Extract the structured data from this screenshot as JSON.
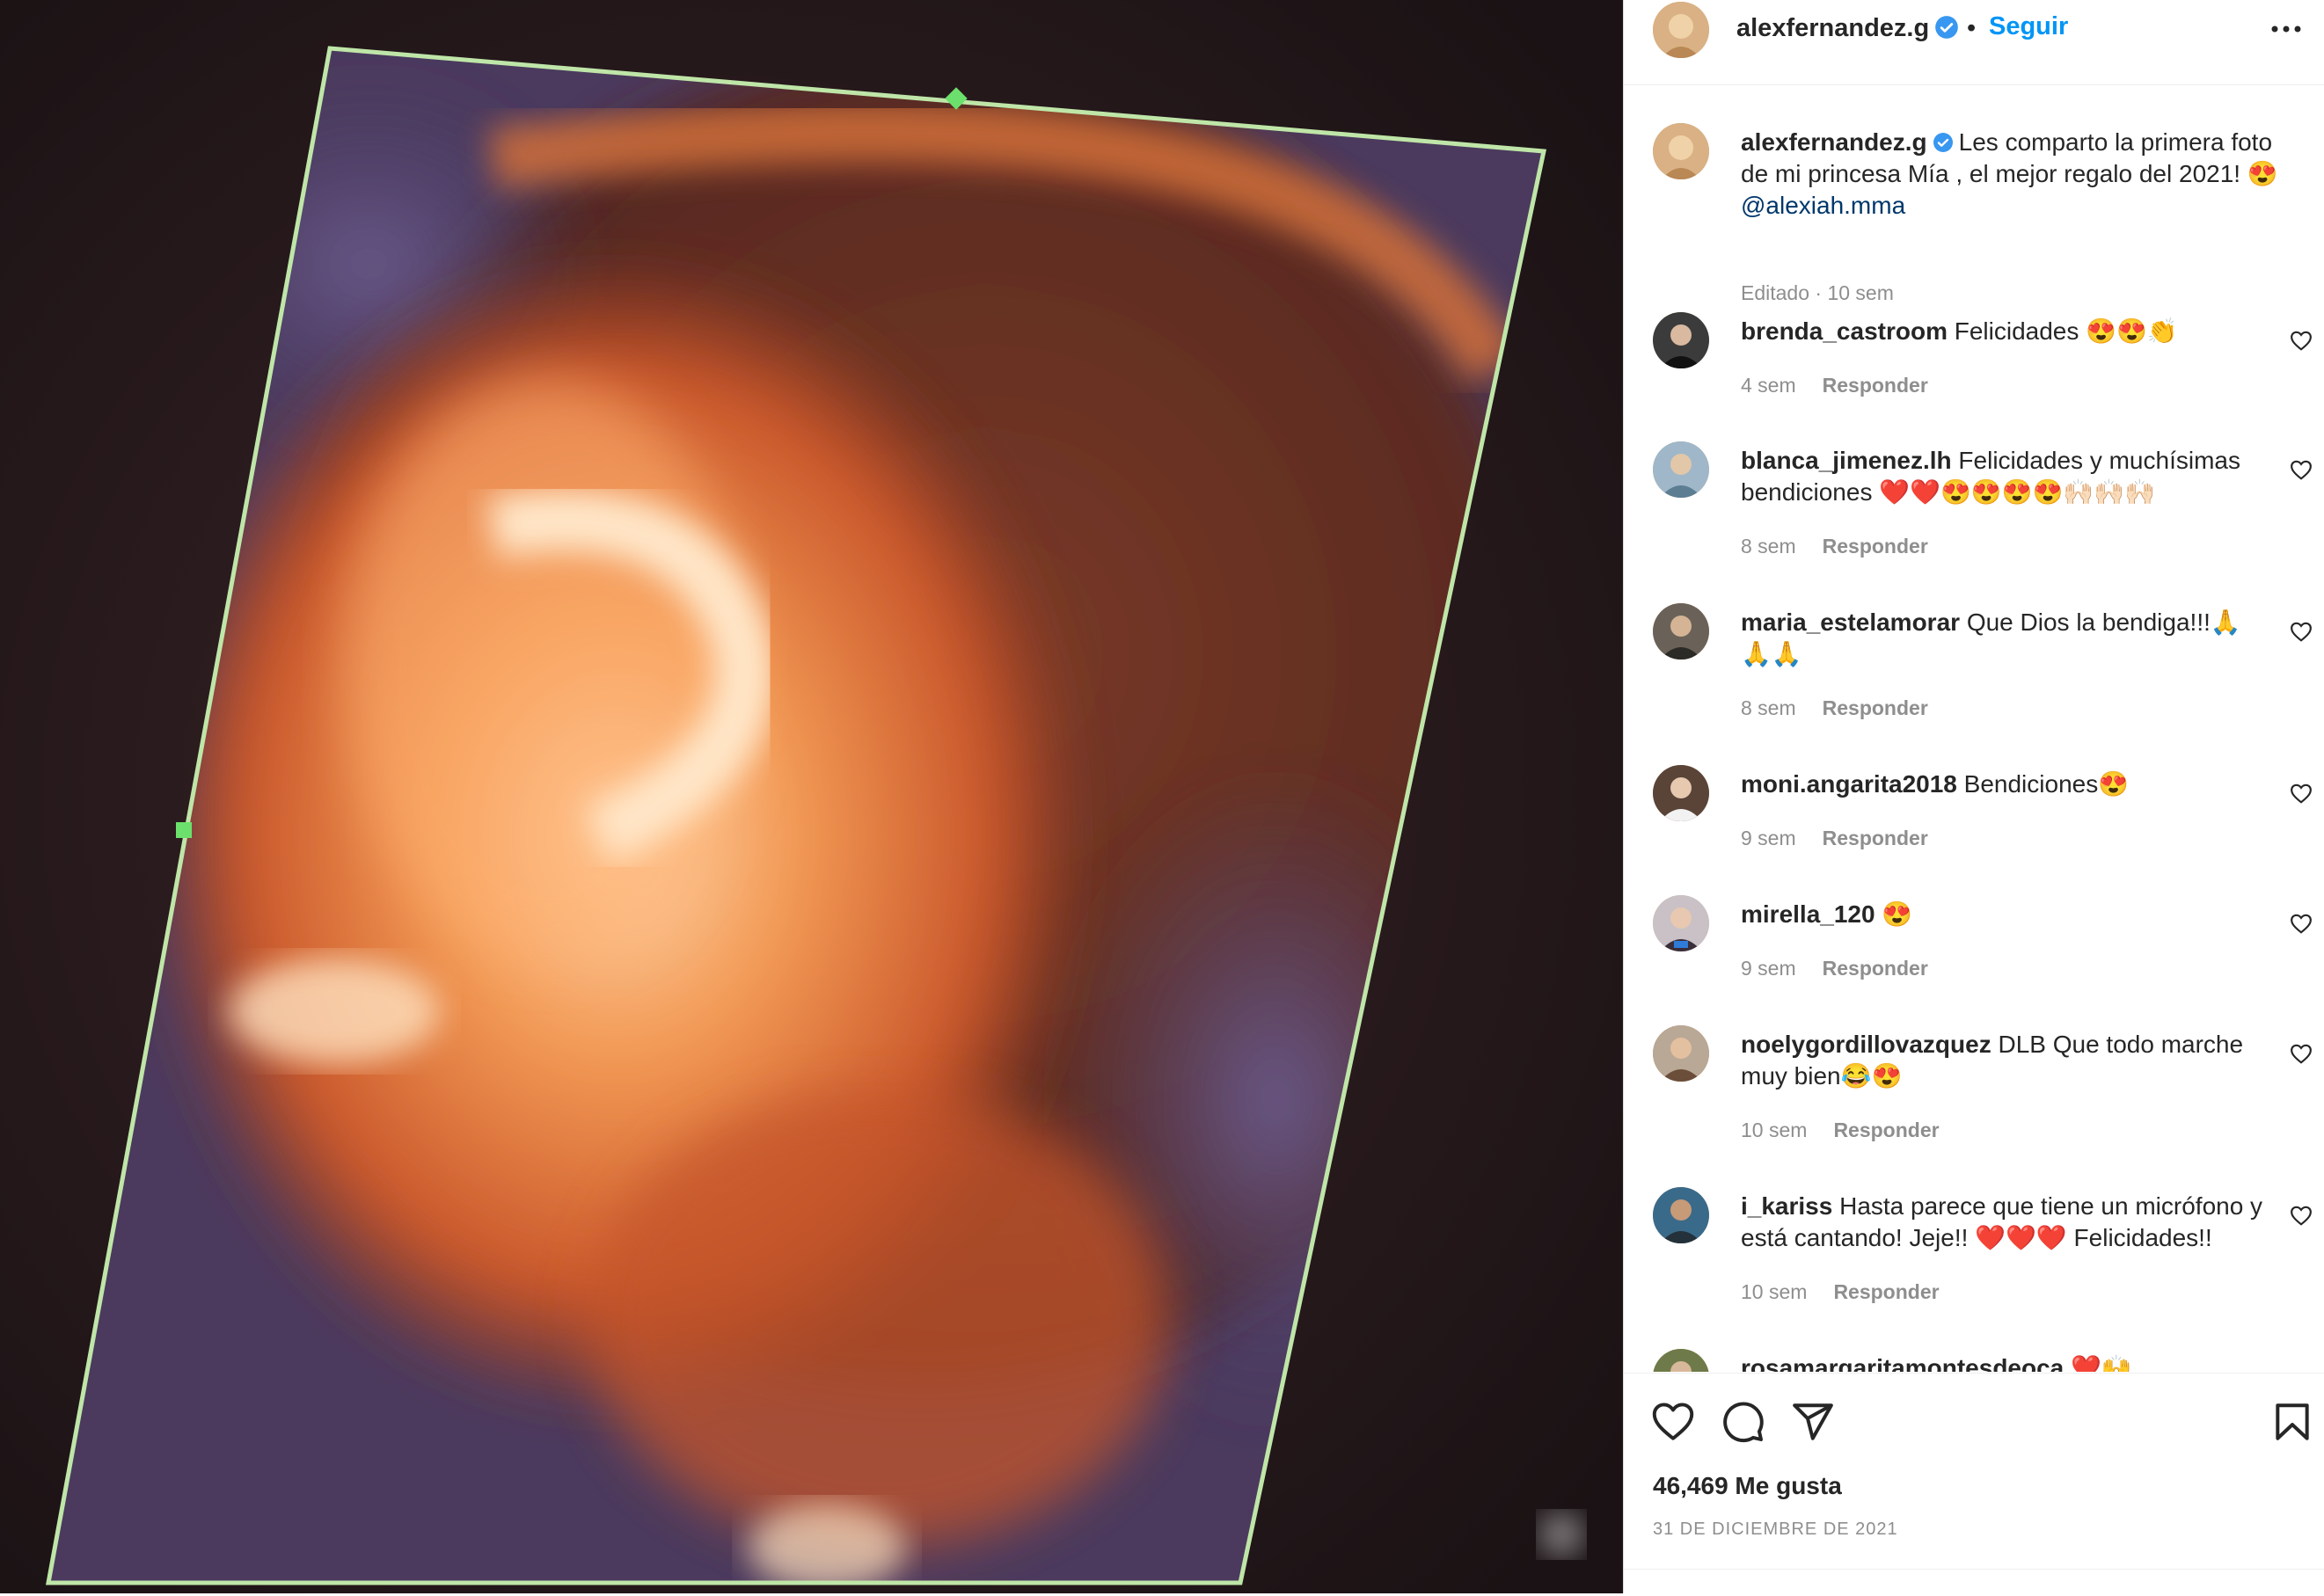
{
  "header": {
    "username": "alexfernandez.g",
    "separator": "•",
    "follow_label": "Seguir"
  },
  "caption": {
    "username": "alexfernandez.g",
    "text": "Les comparto la primera foto de mi princesa Mía , el mejor regalo del 2021! 😍",
    "mention": "@alexiah.mma",
    "meta": "Editado · 10 sem"
  },
  "comments": [
    {
      "username": "brenda_castroom",
      "text": "Felicidades 😍😍👏",
      "time": "4 sem",
      "reply": "Responder"
    },
    {
      "username": "blanca_jimenez.lh",
      "text": "Felicidades y muchísimas bendiciones ❤️❤️😍😍😍😍🙌🏻🙌🏻🙌🏻",
      "time": "8 sem",
      "reply": "Responder"
    },
    {
      "username": "maria_estelamorar",
      "text": "Que Dios la bendiga!!!🙏🙏🙏",
      "time": "8 sem",
      "reply": "Responder"
    },
    {
      "username": "moni.angarita2018",
      "text": "Bendiciones😍",
      "time": "9 sem",
      "reply": "Responder"
    },
    {
      "username": "mirella_120",
      "text": "😍",
      "time": "9 sem",
      "reply": "Responder"
    },
    {
      "username": "noelygordillovazquez",
      "text": "DLB Que todo marche muy bien😂😍",
      "time": "10 sem",
      "reply": "Responder"
    },
    {
      "username": "i_kariss",
      "text": "Hasta parece que tiene un micrófono y está cantando! Jeje!! ❤️❤️❤️ Felicidades!!",
      "time": "10 sem",
      "reply": "Responder"
    },
    {
      "username": "rosamargaritamontesdeoca",
      "text": "❤️🙌",
      "time": "",
      "reply": ""
    }
  ],
  "footer": {
    "likes": "46,469 Me gusta",
    "date": "31 DE DICIEMBRE DE 2021"
  },
  "colors": {
    "accent": "#0095f6",
    "mention": "#00376b",
    "muted": "#8e8e8e",
    "text": "#262626"
  },
  "icons": [
    "verified-badge-icon",
    "more-options-icon",
    "heart-icon",
    "comment-icon",
    "share-icon",
    "bookmark-icon"
  ]
}
